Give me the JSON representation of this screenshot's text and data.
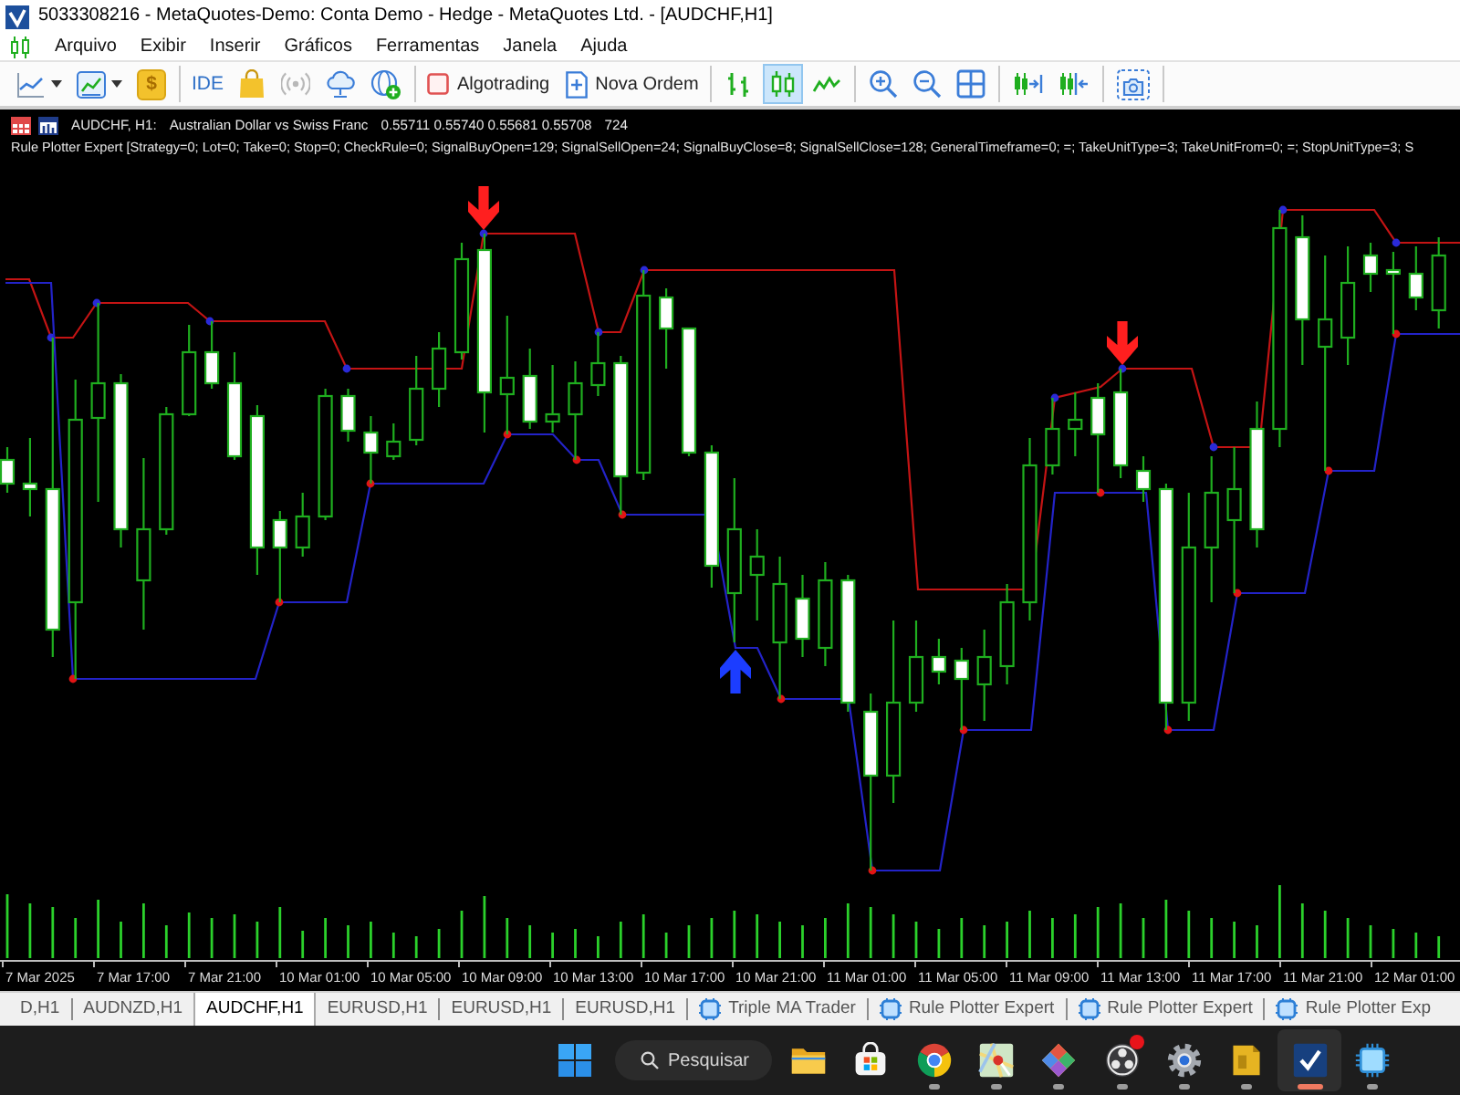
{
  "window": {
    "title": "5033308216 - MetaQuotes-Demo: Conta Demo - Hedge - MetaQuotes Ltd. - [AUDCHF,H1]"
  },
  "menu": [
    "Arquivo",
    "Exibir",
    "Inserir",
    "Gráficos",
    "Ferramentas",
    "Janela",
    "Ajuda"
  ],
  "toolbar": {
    "chart_tools": [
      {
        "kind": "linemenu"
      },
      {
        "kind": "chartmenu"
      },
      {
        "kind": "coin",
        "label": "$"
      }
    ],
    "services": [
      {
        "kind": "ide",
        "label": "IDE"
      },
      {
        "kind": "bag"
      },
      {
        "kind": "signal"
      },
      {
        "kind": "cloud"
      },
      {
        "kind": "globe"
      }
    ],
    "algotrading": {
      "label": "Algotrading",
      "on": false
    },
    "new_order": {
      "label": "Nova Ordem"
    },
    "chart_types": [
      {
        "kind": "bars",
        "selected": false
      },
      {
        "kind": "candles",
        "selected": true
      },
      {
        "kind": "line",
        "selected": false
      }
    ],
    "view_tools": [
      {
        "kind": "zoomin"
      },
      {
        "kind": "zoomout"
      },
      {
        "kind": "tile"
      }
    ],
    "scroll_tools": [
      {
        "kind": "shift"
      },
      {
        "kind": "autoscroll"
      }
    ],
    "capture_tools": [
      {
        "kind": "screenshot"
      }
    ]
  },
  "chart": {
    "symbol": "AUDCHF, H1:",
    "description": "Australian Dollar vs Swiss Franc",
    "prices": "0.55711 0.55740 0.55681 0.55708",
    "volume": "724",
    "expert": "Rule Plotter Expert [Strategy=0; Lot=0; Take=0; Stop=0; CheckRule=0; SignalBuyOpen=129; SignalSellOpen=24; SignalBuyClose=8; SignalSellClose=128; GeneralTimeframe=0; =; TakeUnitType=3; TakeUnitFrom=0; =; StopUnitType=3; S",
    "time_axis": [
      "7 Mar 2025",
      "7 Mar 17:00",
      "7 Mar 21:00",
      "10 Mar 01:00",
      "10 Mar 05:00",
      "10 Mar 09:00",
      "10 Mar 13:00",
      "10 Mar 17:00",
      "10 Mar 21:00",
      "11 Mar 01:00",
      "11 Mar 05:00",
      "11 Mar 09:00",
      "11 Mar 13:00",
      "11 Mar 17:00",
      "11 Mar 21:00",
      "12 Mar 01:00"
    ]
  },
  "chart_tabs": [
    {
      "label": "D,H1",
      "kind": "chart",
      "selected": false
    },
    {
      "label": "AUDNZD,H1",
      "kind": "chart",
      "selected": false
    },
    {
      "label": "AUDCHF,H1",
      "kind": "chart",
      "selected": true
    },
    {
      "label": "EURUSD,H1",
      "kind": "chart",
      "selected": false
    },
    {
      "label": "EURUSD,H1",
      "kind": "chart",
      "selected": false
    },
    {
      "label": "EURUSD,H1",
      "kind": "chart",
      "selected": false
    },
    {
      "label": "Triple MA Trader",
      "kind": "expert",
      "selected": false
    },
    {
      "label": "Rule Plotter Expert",
      "kind": "expert",
      "selected": false
    },
    {
      "label": "Rule Plotter Expert",
      "kind": "expert",
      "selected": false
    },
    {
      "label": "Rule Plotter Exp",
      "kind": "expert",
      "selected": false
    }
  ],
  "taskbar": {
    "search": {
      "placeholder": "Pesquisar"
    },
    "apps": [
      {
        "kind": "folder",
        "running": false,
        "active": false,
        "badge": false
      },
      {
        "kind": "store",
        "running": false,
        "active": false,
        "badge": false
      },
      {
        "kind": "browser",
        "running": true,
        "active": false,
        "badge": false
      },
      {
        "kind": "map",
        "running": true,
        "active": false,
        "badge": false
      },
      {
        "kind": "diamond",
        "running": true,
        "active": false,
        "badge": false
      },
      {
        "kind": "recorder",
        "running": true,
        "active": false,
        "badge": true
      },
      {
        "kind": "gear",
        "running": true,
        "active": false,
        "badge": false
      },
      {
        "kind": "document",
        "running": true,
        "active": false,
        "badge": false
      },
      {
        "kind": "check",
        "running": true,
        "active": true,
        "badge": false
      },
      {
        "kind": "chip",
        "running": true,
        "active": false,
        "badge": false
      }
    ]
  }
}
